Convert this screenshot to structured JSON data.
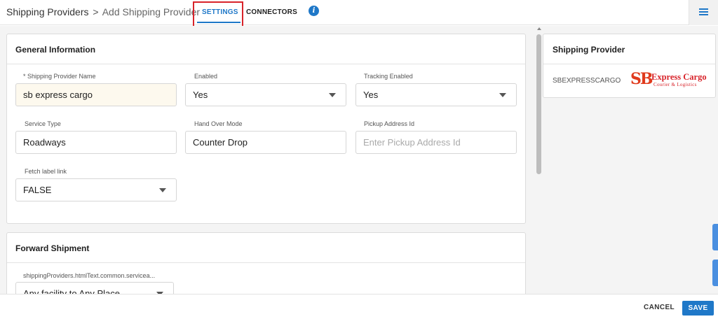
{
  "header": {
    "breadcrumb_parent": "Shipping Providers",
    "breadcrumb_separator": ">",
    "breadcrumb_current": "Add Shipping Provider",
    "tabs": [
      {
        "label": "SETTINGS",
        "active": true
      },
      {
        "label": "CONNECTORS",
        "active": false
      }
    ],
    "info_icon_glyph": "i",
    "accent_color": "#1f78c8",
    "highlight_color": "#d8232a"
  },
  "general": {
    "title": "General Information",
    "fields": {
      "provider_name": {
        "label": "*  Shipping Provider Name",
        "value": "sb express cargo"
      },
      "enabled": {
        "label": "Enabled",
        "value": "Yes"
      },
      "tracking_enabled": {
        "label": "Tracking Enabled",
        "value": "Yes"
      },
      "service_type": {
        "label": "Service Type",
        "value": "Roadways"
      },
      "hand_over_mode": {
        "label": "Hand Over Mode",
        "value": "Counter Drop"
      },
      "pickup_address_id": {
        "label": "Pickup Address Id",
        "value": "",
        "placeholder": "Enter Pickup Address Id"
      },
      "fetch_label_link": {
        "label": "Fetch label link",
        "value": "FALSE"
      }
    }
  },
  "forward": {
    "title": "Forward Shipment",
    "field_label": "shippingProviders.htmlText.common.serviceа...",
    "field_value": "Any facility to Any Place"
  },
  "side": {
    "title": "Shipping Provider",
    "provider_code": "SBEXPRESSCARGO",
    "logo": {
      "mark": "SB",
      "name": "Express Cargo",
      "tagline": "Courier & Logistics"
    }
  },
  "footer": {
    "cancel_label": "CANCEL",
    "save_label": "SAVE"
  }
}
